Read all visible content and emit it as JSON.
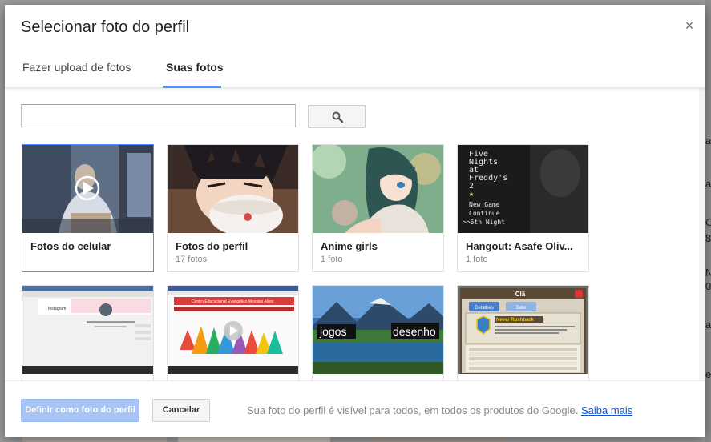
{
  "dialog": {
    "title": "Selecionar foto do perfil",
    "close_symbol": "×",
    "tabs": [
      {
        "label": "Fazer upload de fotos",
        "active": false
      },
      {
        "label": "Suas fotos",
        "active": true
      }
    ]
  },
  "search": {
    "value": "",
    "placeholder": "",
    "button_icon": "search-icon"
  },
  "albums": [
    {
      "title": "Fotos do celular",
      "count": "",
      "selected": true,
      "has_video": true
    },
    {
      "title": "Fotos do perfil",
      "count": "17 fotos",
      "selected": false
    },
    {
      "title": "Anime girls",
      "count": "1 foto",
      "selected": false
    },
    {
      "title": "Hangout: Asafe Oliv...",
      "count": "1 foto",
      "selected": false
    }
  ],
  "row2_thumbs": {
    "t2_logos": [
      "jogos",
      "desenho"
    ],
    "t3_title": "Clã",
    "t3_tabs": [
      "Detalhes",
      "Bate"
    ],
    "t3_name": "Never Rushback",
    "t1_header": "Instagram",
    "t2_banner": "Centro Educacional Evangélico Messias Alves",
    "t4_game_lines": [
      "Five",
      "Nights",
      "at",
      "Freddy's",
      "2",
      "★",
      "New Game",
      "Continue",
      ">>6th Night"
    ]
  },
  "footer": {
    "primary_label": "Definir como foto do perfil",
    "cancel_label": "Cancelar",
    "note": "Sua foto do perfil é visível para todos, em todos os produtos do Google.",
    "link": "Saiba mais"
  },
  "background": {
    "right_fragments": [
      "a",
      "a",
      "C",
      "8",
      "N",
      "0",
      "a",
      "e"
    ]
  },
  "colors": {
    "accent": "#4d90fe",
    "primary_disabled": "#a7c4f4",
    "link": "#1155cc"
  }
}
